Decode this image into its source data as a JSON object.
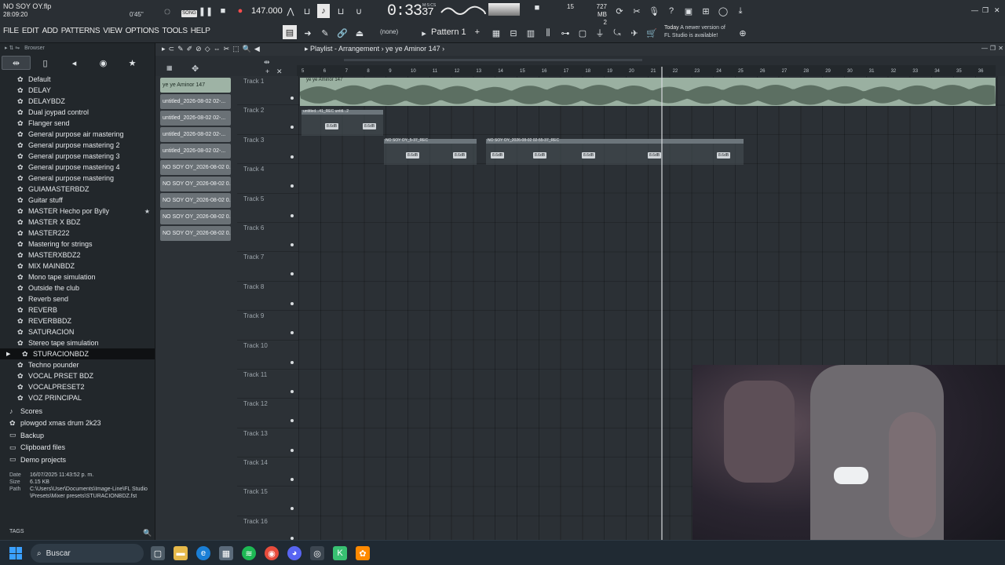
{
  "window": {
    "project_title": "NO SOY OY.flp",
    "clock": "28:09:20",
    "beat_indicator": "0'45\"",
    "song_badge": "SONG",
    "bpm": "147.000",
    "time": "0:33",
    "time_frac": "37",
    "time_label": "M:S:CS",
    "memory_small": "15",
    "memory": "727 MB",
    "memory_cpu": "2",
    "pattern": "Pattern 1",
    "none_label": "(none)",
    "news_date": "Today",
    "news_text": "A newer version of",
    "news_text2": "FL Studio is available!"
  },
  "menu": [
    "FILE",
    "EDIT",
    "ADD",
    "PATTERNS",
    "VIEW",
    "OPTIONS",
    "TOOLS",
    "HELP"
  ],
  "browser": {
    "header": "Browser",
    "presets": [
      "Default",
      "DELAY",
      "DELAYBDZ",
      "Dual joypad control",
      "Flanger send",
      "General purpose air mastering",
      "General purpose mastering 2",
      "General purpose mastering 3",
      "General purpose mastering 4",
      "General purpose mastering",
      "GUIAMASTERBDZ",
      "Guitar stuff",
      "MASTER Hecho por Bylly",
      "MASTER X BDZ",
      "MASTER222",
      "Mastering for strings",
      "MASTERXBDZ2",
      "MIX MAINBDZ",
      "Mono tape simulation",
      "Outside the club",
      "Reverb send",
      "REVERB",
      "REVERBBDZ",
      "SATURACION",
      "Stereo tape simulation",
      "STURACIONBDZ",
      "Techno pounder",
      "VOCAL PRSET BDZ",
      "VOCALPRESET2",
      "VOZ PRINCIPAL"
    ],
    "selected_index": 25,
    "folders": [
      "Scores",
      "plowgod xmas drum 2k23",
      "Backup",
      "Clipboard files",
      "Demo projects"
    ],
    "info": {
      "date_label": "Date",
      "date": "16/07/2025 11:43:52 p. m.",
      "size_label": "Size",
      "size": "6.15 KB",
      "path_label": "Path",
      "path": "C:\\Users\\User\\Documents\\Image-Line\\FL Studio\\Presets\\Mixer presets\\STURACIONBDZ.fst"
    },
    "tags_label": "TAGS"
  },
  "playlist": {
    "title": "Playlist - Arrangement",
    "pattern_name": "ye ye Aminor 147",
    "clips": [
      "ye ye Aminor 147",
      "untitled_2026-08-02 02-...",
      "untitled_2026-08-02 02-...",
      "untitled_2026-08-02 02-...",
      "untitled_2026-08-02 02-...",
      "NO SOY OY_2026-08-02 0...",
      "NO SOY OY_2026-08-02 0...",
      "NO SOY OY_2026-08-02 0...",
      "NO SOY OY_2026-08-02 0...",
      "NO SOY OY_2026-08-02 0..."
    ],
    "tracks": [
      "Track 1",
      "Track 2",
      "Track 3",
      "Track 4",
      "Track 5",
      "Track 6",
      "Track 7",
      "Track 8",
      "Track 9",
      "Track 10",
      "Track 11",
      "Track 12",
      "Track 13",
      "Track 14",
      "Track 15",
      "Track 16"
    ],
    "ruler": [
      "5",
      "6",
      "7",
      "8",
      "9",
      "10",
      "11",
      "12",
      "13",
      "14",
      "15",
      "16",
      "17",
      "18",
      "19",
      "20",
      "21",
      "22",
      "23",
      "24",
      "25",
      "26",
      "27",
      "28",
      "29",
      "30",
      "31",
      "32",
      "33",
      "34",
      "35",
      "36"
    ],
    "track1_clip_label": "ye ye Aminor 147",
    "track2_clip_label": "untitled...41_REC  untitl...2",
    "track3_clip_labels": [
      "NO SOY OY_5-37_REC",
      "NO S...t_2",
      "NO...1",
      "NO SOY OY_..55-37_REC",
      "NO..._REC",
      "NO SOY OY_2026-08-02 02-55-37_REC",
      "NO SOY...rt_6"
    ],
    "db_label": "8.6dB"
  },
  "taskbar": {
    "search_placeholder": "Buscar"
  },
  "colors": {
    "accent": "#9ab0a1",
    "background": "#2c3136",
    "taskbar": "#202a33"
  }
}
